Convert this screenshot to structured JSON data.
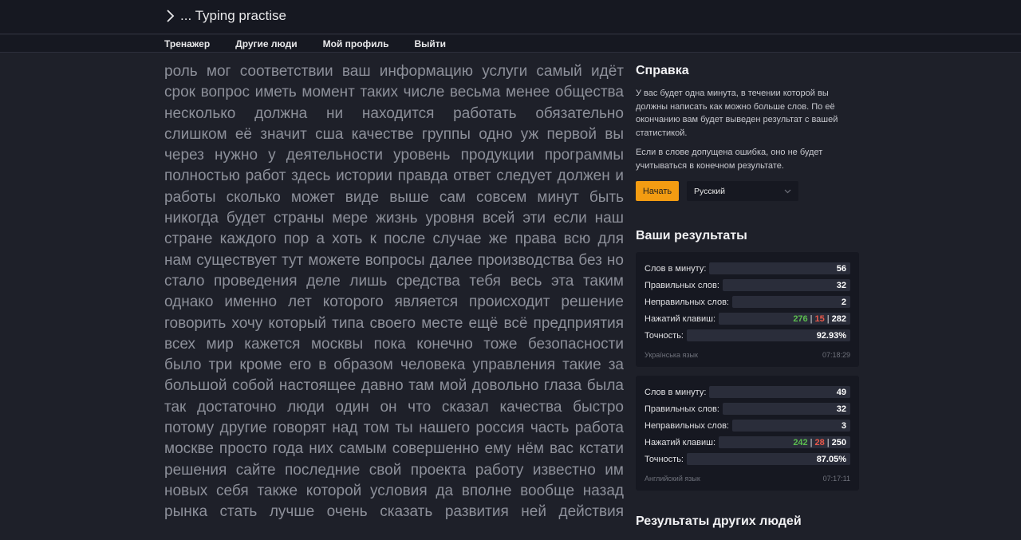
{
  "app": {
    "title": "... Typing practise"
  },
  "nav": {
    "items": [
      "Тренажер",
      "Другие люди",
      "Мой профиль",
      "Выйти"
    ]
  },
  "practice_text": [
    "роль мог соответствии ваш информацию услуги самый идёт",
    "срок вопрос иметь момент таких числе весьма менее общества",
    "несколько должна ни находится работать обязательно",
    "слишком её значит сша качестве группы одно уж первой вы",
    "через нужно у деятельности уровень продукции программы",
    "полностью работ здесь истории правда ответ следует должен и",
    "работы сколько может виде выше сам совсем минут быть",
    "никогда будет страны мере жизнь уровня всей эти если наш",
    "стране каждого пор а хоть к после случае же права всю для",
    "нам существует тут можете вопросы далее производства без но",
    "стало проведения деле лишь средства тебя весь эта таким",
    "однако именно лет которого является происходит решение",
    "говорить хочу который типа своего месте ещё всё предприятия",
    "всех мир кажется москвы пока конечно тоже безопасности",
    "было три кроме его в образом человека управления такие за",
    "большой собой настоящее давно там мой довольно глаза была",
    "так достаточно люди один он что сказал качества быстро",
    "потому другие говорят над том ты нашего россия часть работа",
    "москве просто года них самым совершенно ему нём вас кстати",
    "решения сайте последние свой проекта работу известно им",
    "новых себя также которой условия да вполне вообще назад",
    "рынка стать лучше очень сказать развития ней действия"
  ],
  "help": {
    "title": "Справка",
    "p1": "У вас будет одна минута, в течении которой вы должны написать как можно больше слов. По её окончанию вам будет выведен результат с вашей статистикой.",
    "p2": "Если в слове допущена ошибка, оно не будет учитываться в конечном результате.",
    "start_label": "Начать",
    "language_value": "Русский"
  },
  "results": {
    "title": "Ваши результаты",
    "labels": {
      "wpm": "Слов в минуту:",
      "correct": "Правильных слов:",
      "wrong": "Неправильных слов:",
      "keys": "Нажатий клавиш:",
      "accuracy": "Точность:"
    },
    "cards": [
      {
        "wpm": "56",
        "correct": "32",
        "wrong": "2",
        "keys_ok": "276",
        "keys_bad": "15",
        "keys_total": "282",
        "accuracy": "92.93%",
        "language": "Українська язык",
        "time": "07:18:29"
      },
      {
        "wpm": "49",
        "correct": "32",
        "wrong": "3",
        "keys_ok": "242",
        "keys_bad": "28",
        "keys_total": "250",
        "accuracy": "87.05%",
        "language": "Английский язык",
        "time": "07:17:11"
      }
    ]
  },
  "others": {
    "title": "Результаты других людей"
  },
  "colors": {
    "accent": "#f39c12",
    "good": "#5bbd4f",
    "bad": "#e9584a",
    "background": "#1e2029",
    "panel": "#161821"
  }
}
